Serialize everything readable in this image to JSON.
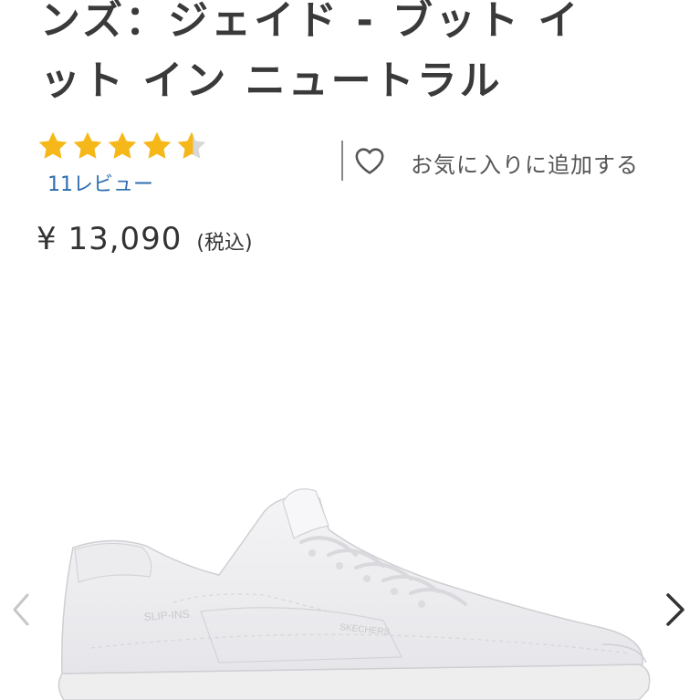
{
  "product": {
    "title_line1": "ンズ：ジェイド - ブット イ",
    "title_line2": "ット イン ニュートラル",
    "rating": 4.5,
    "rating_max": 5,
    "review_link": "11レビュー",
    "favorite_label": "お気に入りに追加する",
    "price": "¥ 13,090",
    "tax_note": "(税込)",
    "image_text": {
      "side_logo": "SLIP-INS",
      "brand": "SKECHERS"
    }
  },
  "carousel": {
    "prev_icon": "chevron-left-icon",
    "next_icon": "chevron-right-icon"
  },
  "colors": {
    "star": "#f6b818",
    "star_empty": "#d8d8d8",
    "link": "#2e6eb0",
    "text": "#333333"
  }
}
